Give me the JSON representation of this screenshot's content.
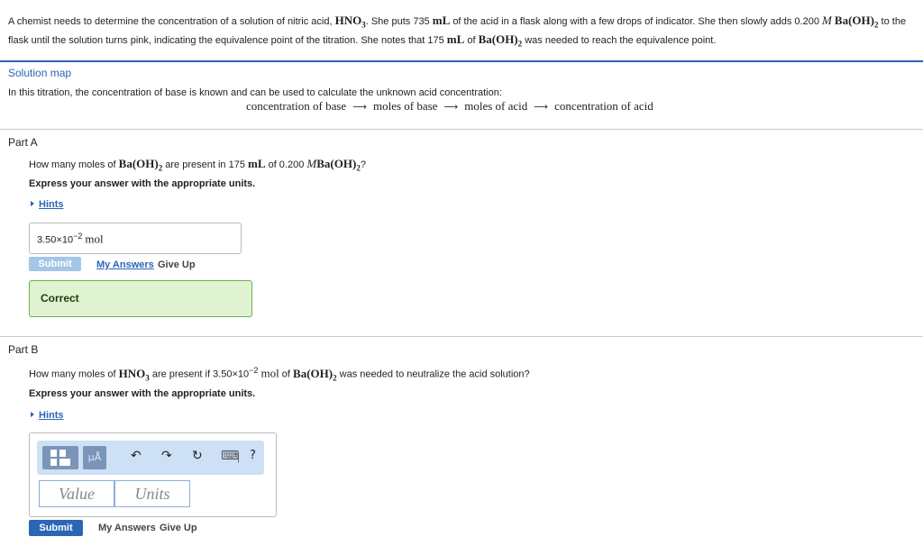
{
  "problem": {
    "t1": "A chemist needs to determine the concentration of a solution of nitric acid,",
    "hno3_main": "HNO",
    "hno3_sub": "3",
    "t2": ". She puts 735",
    "ml": "mL",
    "t3": "of the acid in a flask along with a few drops of indicator. She then slowly adds 0.200",
    "molar": "M",
    "baoh_main": "Ba(OH)",
    "baoh_sub": "2",
    "t4": "to the",
    "t5": "flask until the solution turns pink, indicating the equivalence point of the titration. She notes that 175",
    "t6": "of",
    "t7": "was needed to reach the equivalence point."
  },
  "solution_map": {
    "title": "Solution map",
    "text": "In this titration, the concentration of base is known and can be used to calculate the unknown acid concentration:",
    "steps": [
      "concentration of base",
      "moles of base",
      "moles of acid",
      "concentration of acid"
    ]
  },
  "partA": {
    "title": "Part A",
    "q1": "How many moles of",
    "q2": "are present in 175",
    "q3": "of 0.200",
    "q4": "?",
    "instruction": "Express your answer with the appropriate units.",
    "hints": "Hints",
    "answer_value": "3.50×10",
    "answer_exp": "−2",
    "answer_unit": "mol",
    "submit": "Submit",
    "my_answers": "My Answers",
    "give_up": "Give Up",
    "feedback": "Correct"
  },
  "partB": {
    "title": "Part B",
    "q1": "How many moles of",
    "q2": "are present if 3.50×10",
    "q2_exp": "−2",
    "q3": "mol",
    "q4": "of",
    "q5": "was needed to neutralize the acid solution?",
    "instruction": "Express your answer with the appropriate units.",
    "hints": "Hints",
    "value_placeholder": "Value",
    "units_placeholder": "Units",
    "submit": "Submit",
    "my_answers": "My Answers",
    "give_up": "Give Up",
    "toolbar": {
      "mu_label": "μÅ",
      "undo": "↶",
      "redo": "↷",
      "reset": "↻",
      "keyboard": "⌨",
      "help": "?"
    }
  },
  "colors": {
    "link": "#2a66b5",
    "correct_bg": "#dff3d0",
    "correct_border": "#6ab04c"
  }
}
